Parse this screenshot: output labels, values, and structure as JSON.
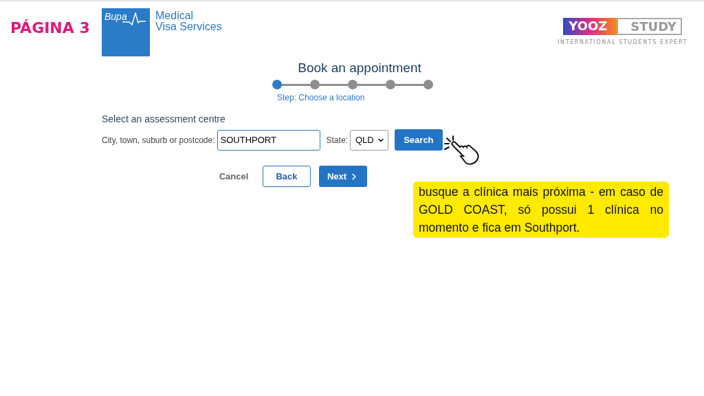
{
  "page_label": "PÁGINA 3",
  "bupa_logo": {
    "wordmark": "Bupa",
    "service_line_1": "Medical",
    "service_line_2": "Visa Services"
  },
  "partner_logo": {
    "part_1": "YOOZ",
    "part_2": "STUDY",
    "tagline": "INTERNATIONAL STUDENTS EXPERT"
  },
  "title": "Book an appointment",
  "steps": [
    {
      "selected": true
    },
    {
      "selected": false
    },
    {
      "selected": false
    },
    {
      "selected": false
    },
    {
      "selected": false
    }
  ],
  "step_caption": "Step: Choose a location",
  "section_heading": "Select an assessment centre",
  "location_field": {
    "label": "City, town, suburb or postcode:",
    "value": "SOUTHPORT"
  },
  "state_field": {
    "label": "State:",
    "value": "QLD"
  },
  "search_button": "Search",
  "actions": {
    "cancel": "Cancel",
    "back": "Back",
    "next": "Next"
  },
  "note": "busque a clínica mais próxima - em caso de GOLD COAST, só possui 1 clínica no momento e fica em Southport."
}
